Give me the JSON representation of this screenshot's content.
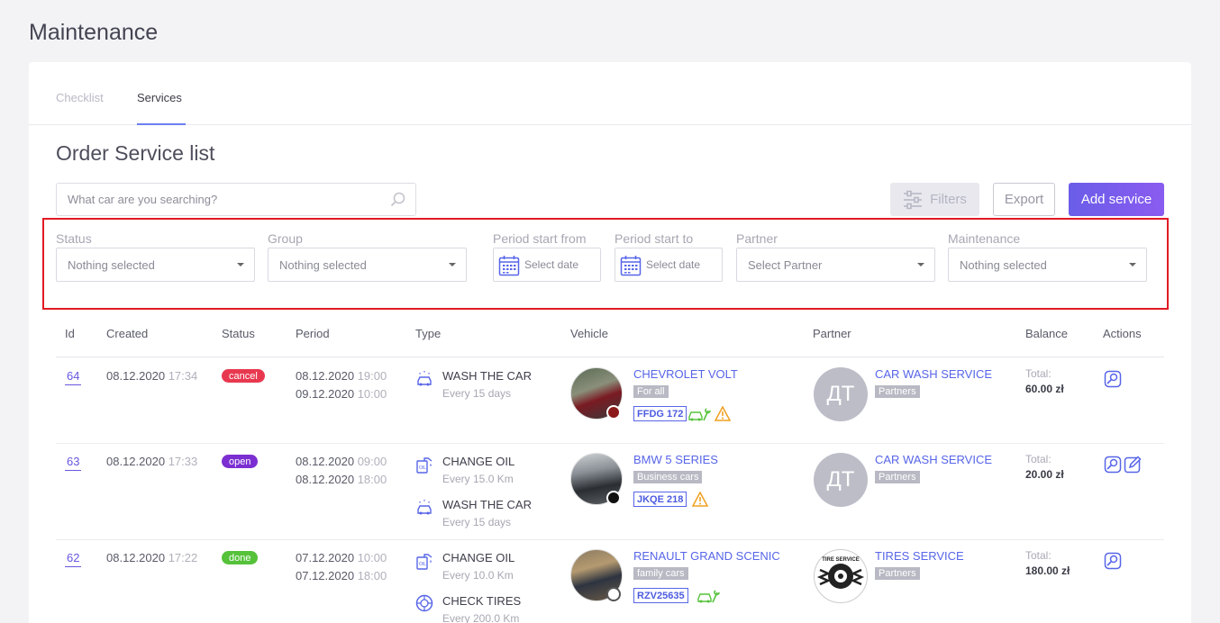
{
  "page": {
    "title": "Maintenance"
  },
  "tabs": [
    {
      "label": "Checklist"
    },
    {
      "label": "Services"
    }
  ],
  "section_title": "Order Service list",
  "search": {
    "placeholder": "What car are you searching?"
  },
  "toolbar": {
    "filters_label": "Filters",
    "export_label": "Export",
    "add_label": "Add service"
  },
  "filters": {
    "status": {
      "label": "Status",
      "value": "Nothing selected"
    },
    "group": {
      "label": "Group",
      "value": "Nothing selected"
    },
    "period_from": {
      "label": "Period start from",
      "value": "Select date"
    },
    "period_to": {
      "label": "Period start to",
      "value": "Select date"
    },
    "partner": {
      "label": "Partner",
      "value": "Select Partner"
    },
    "maintenance": {
      "label": "Maintenance",
      "value": "Nothing selected"
    }
  },
  "table": {
    "headers": [
      "Id",
      "Created",
      "Status",
      "Period",
      "Type",
      "Vehicle",
      "Partner",
      "Balance",
      "Actions"
    ],
    "rows": [
      {
        "id": "64",
        "created_date": "08.12.2020",
        "created_time": "17:34",
        "status": "cancel",
        "status_color": "#e8384f",
        "period_start_date": "08.12.2020",
        "period_start_time": "19:00",
        "period_end_date": "09.12.2020",
        "period_end_time": "10:00",
        "types": [
          {
            "title": "WASH THE CAR",
            "sub": "Every 15 days",
            "icon": "car-wash-icon"
          }
        ],
        "vehicle": {
          "name": "CHEVROLET VOLT",
          "group": "For all",
          "plate": "FFDG 172",
          "dot_color": "#8b1a1a"
        },
        "partner": {
          "initials": "ДТ",
          "name": "CAR WASH SERVICE",
          "tag": "Partners"
        },
        "balance_label": "Total:",
        "balance": "60.00 zł"
      },
      {
        "id": "63",
        "created_date": "08.12.2020",
        "created_time": "17:33",
        "status": "open",
        "status_color": "#7b2fd1",
        "period_start_date": "08.12.2020",
        "period_start_time": "09:00",
        "period_end_date": "08.12.2020",
        "period_end_time": "18:00",
        "types": [
          {
            "title": "CHANGE OIL",
            "sub": "Every 15.0 Km",
            "icon": "oil-change-icon"
          },
          {
            "title": "WASH THE CAR",
            "sub": "Every 15 days",
            "icon": "car-wash-icon"
          }
        ],
        "vehicle": {
          "name": "BMW 5 SERIES",
          "group": "Business cars",
          "plate": "JKQE 218",
          "dot_color": "#111111"
        },
        "partner": {
          "initials": "ДТ",
          "name": "CAR WASH SERVICE",
          "tag": "Partners"
        },
        "balance_label": "Total:",
        "balance": "20.00 zł"
      },
      {
        "id": "62",
        "created_date": "08.12.2020",
        "created_time": "17:22",
        "status": "done",
        "status_color": "#55c23a",
        "period_start_date": "07.12.2020",
        "period_start_time": "10:00",
        "period_end_date": "07.12.2020",
        "period_end_time": "18:00",
        "types": [
          {
            "title": "CHANGE OIL",
            "sub": "Every 10.0 Km",
            "icon": "oil-change-icon"
          },
          {
            "title": "CHECK TIRES",
            "sub": "Every 200.0 Km",
            "icon": "tire-icon"
          }
        ],
        "vehicle": {
          "name": "RENAULT GRAND SCENIC",
          "group": "family cars",
          "plate": "RZV25635",
          "dot_color": "#ffffff"
        },
        "partner": {
          "logo_text": "TIRE SERVICE",
          "name": "TIRES SERVICE",
          "tag": "Partners"
        },
        "balance_label": "Total:",
        "balance": "180.00 zł"
      }
    ]
  }
}
